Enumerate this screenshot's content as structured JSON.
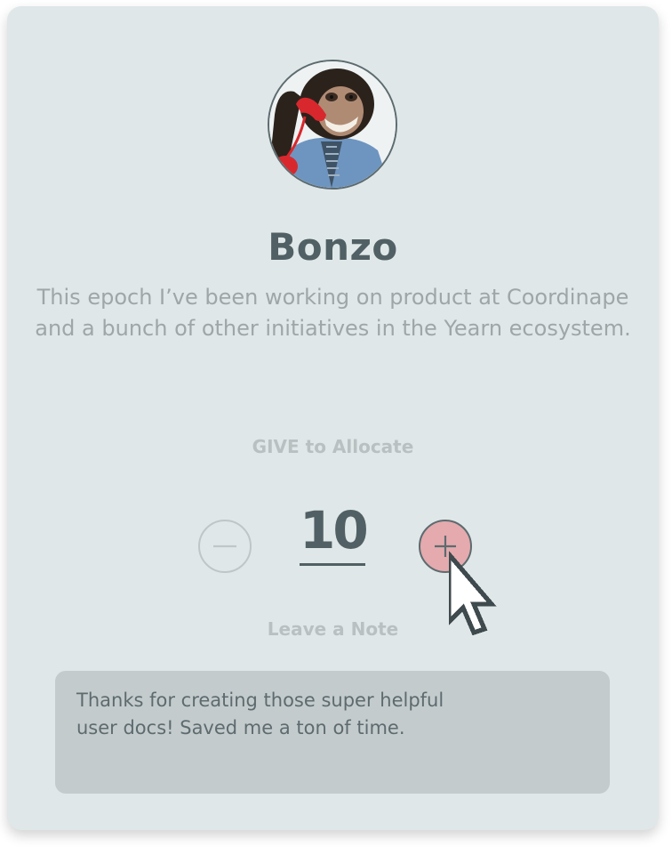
{
  "profile": {
    "name": "Bonzo",
    "bio": "This epoch I’ve been working on product at Coordinape and a bunch of other initiatives in the Yearn ecosystem.",
    "avatar_icon": "avatar-chimp-on-phone"
  },
  "allocation": {
    "label": "GIVE to Allocate",
    "value": "10",
    "decrement_icon": "minus-icon",
    "increment_icon": "plus-icon"
  },
  "note": {
    "label": "Leave a Note",
    "lines": [
      "Thanks for creating those super helpful",
      "user docs! Saved me a ton of time."
    ]
  },
  "colors": {
    "card_background": "#dfe7e8",
    "primary_text": "#516064",
    "accent_plus": "#e4aaae",
    "note_background": "#c4cbcd"
  },
  "pointer": {
    "icon": "pointer-cursor-icon"
  }
}
